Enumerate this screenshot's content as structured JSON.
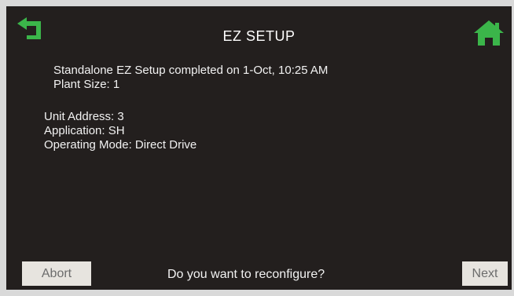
{
  "header": {
    "title": "EZ SETUP",
    "back_icon": "back-arrow-icon",
    "home_icon": "home-icon",
    "icon_color": "#3bb54a"
  },
  "summary": {
    "completed_text": "Standalone EZ Setup completed on 1-Oct, 10:25 AM",
    "plant_size": "Plant Size: 1"
  },
  "details": {
    "unit_address": "Unit Address: 3",
    "application": "Application: SH",
    "operating_mode": "Operating Mode: Direct Drive"
  },
  "footer": {
    "abort_label": "Abort",
    "prompt": "Do you want to reconfigure?",
    "next_label": "Next"
  }
}
